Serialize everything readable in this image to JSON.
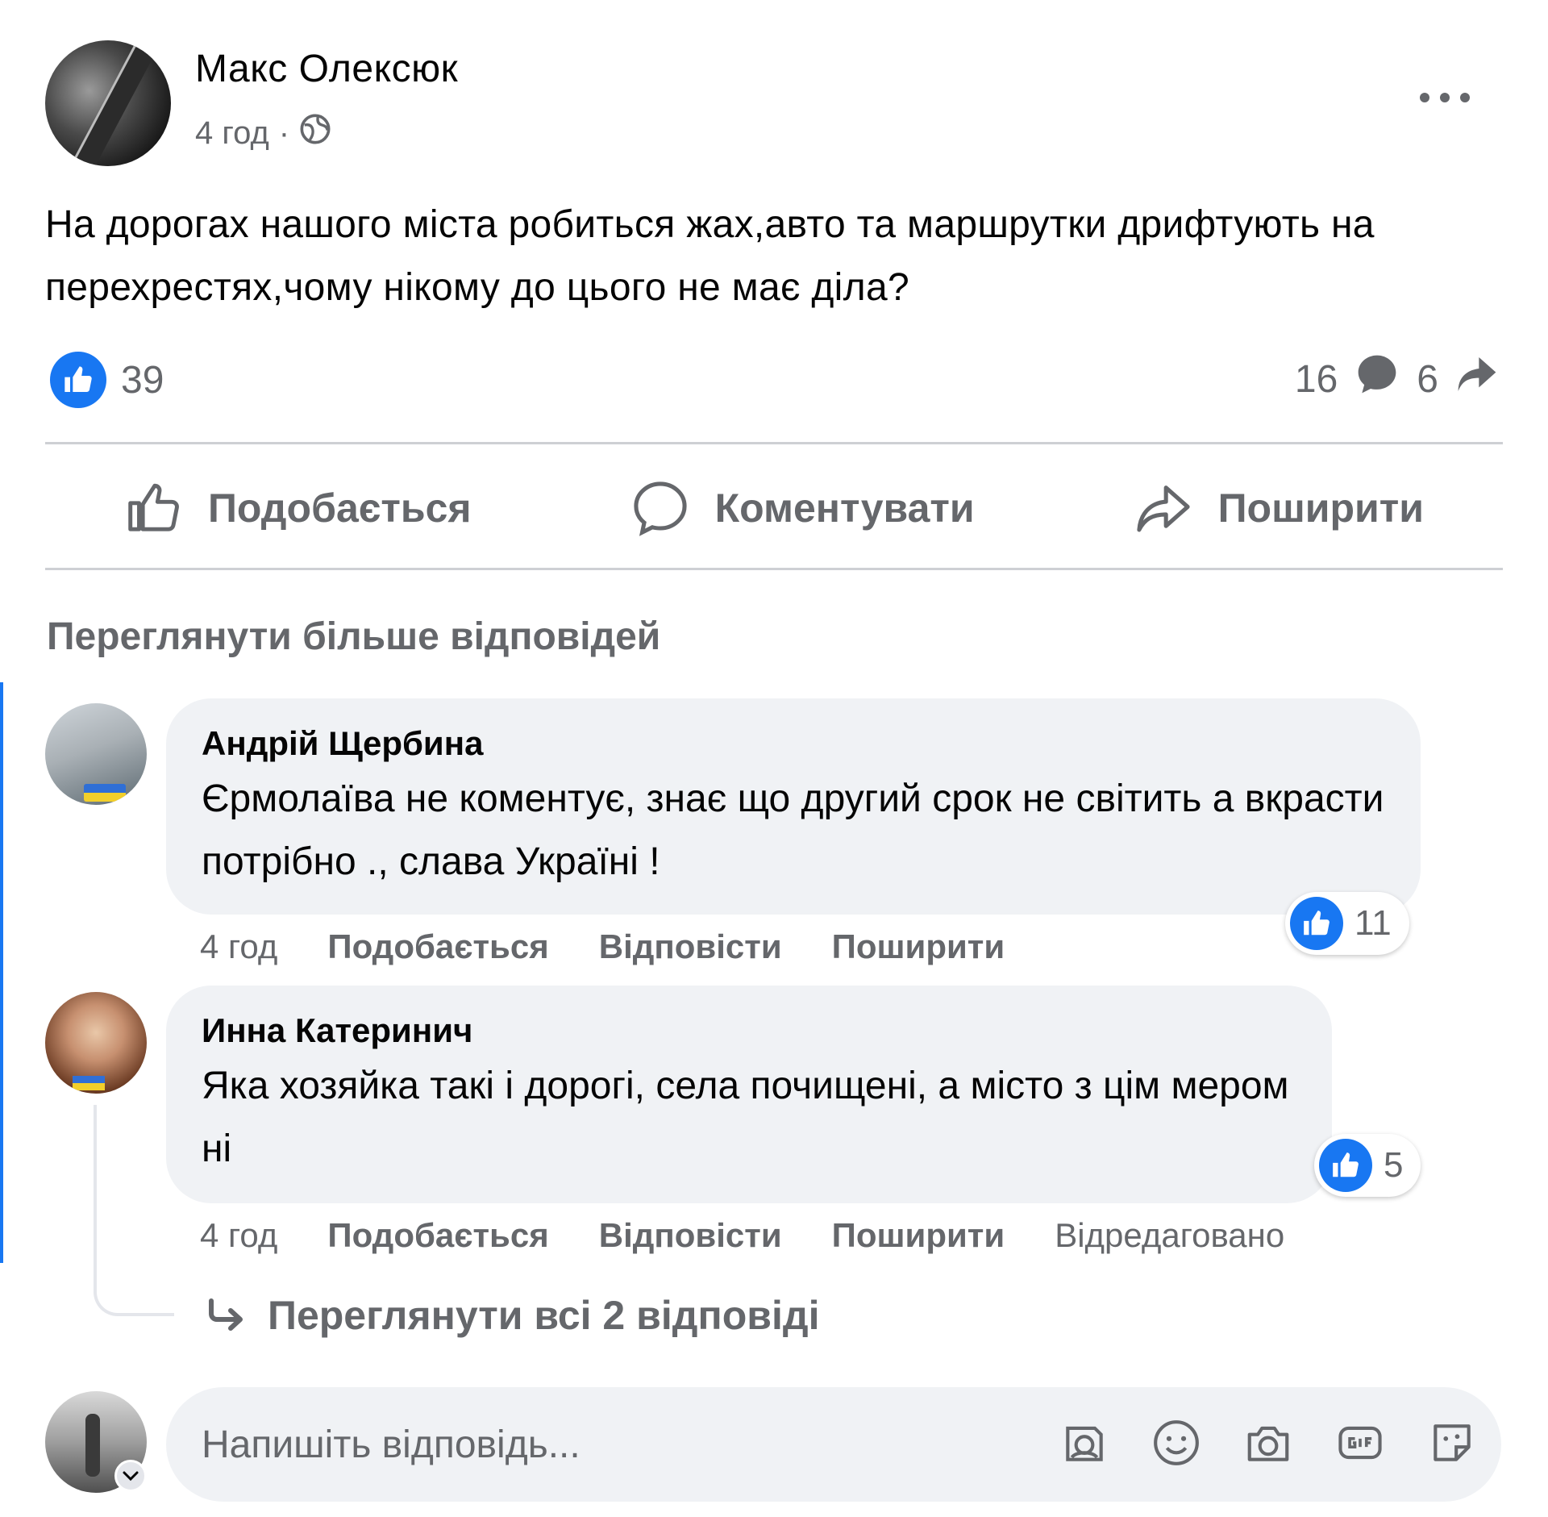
{
  "post": {
    "author": "Макс Олексюк",
    "time": "4 год",
    "separator": "·",
    "text": "На дорогах нашого міста робиться жах,авто та маршрутки дрифтують на перехрестях,чому нікому до цього не має діла?",
    "likes": "39",
    "comments": "16",
    "shares": "6"
  },
  "actions": {
    "like": "Подобається",
    "comment": "Коментувати",
    "share": "Поширити"
  },
  "view_more_label": "Переглянути більше відповідей",
  "comments": [
    {
      "author": "Андрій Щербина",
      "text": "Єрмолаїва не коментує, знає що другий срок не світить а вкрасти потрібно ., слава Україні !",
      "likes": "11",
      "time": "4 год",
      "like_label": "Подобається",
      "reply_label": "Відповісти",
      "share_label": "Поширити"
    },
    {
      "author": "Инна Катеринич",
      "text": "Яка хозяйка такі і дорогі, села почищені, а місто з цім мером ні",
      "likes": "5",
      "time": "4 год",
      "like_label": "Подобається",
      "reply_label": "Відповісти",
      "share_label": "Поширити",
      "edited": "Відредаговано"
    }
  ],
  "view_replies_label": "Переглянути всі 2 відповіді",
  "reply_box": {
    "placeholder": "Напишіть відповідь..."
  },
  "icons": {
    "globe": "globe-icon",
    "more": "more-icon",
    "like": "thumbs-up-icon",
    "comment": "comment-icon",
    "share": "share-icon",
    "reply_arrow": "reply-arrow-icon",
    "avatar_sticker": "avatar-sticker-icon",
    "emoji": "emoji-icon",
    "camera": "camera-icon",
    "gif": "gif-icon",
    "sticker": "sticker-icon"
  },
  "colors": {
    "accent": "#1877f2",
    "muted_text": "#65676b",
    "bubble": "#f0f2f5"
  }
}
